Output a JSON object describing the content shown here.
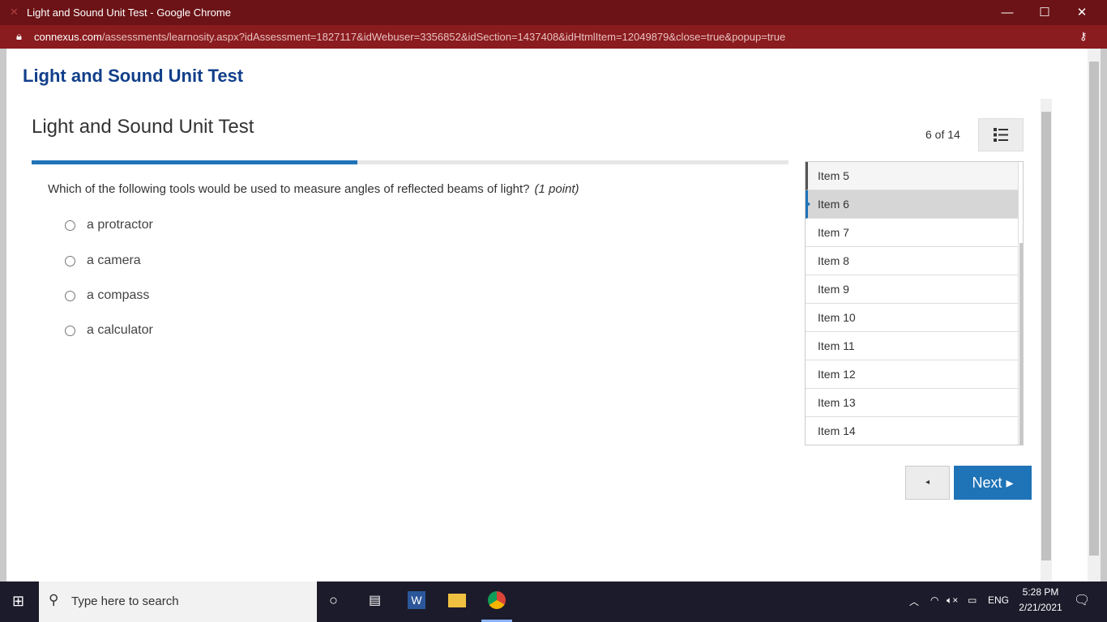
{
  "window": {
    "title": "Light and Sound Unit Test - Google Chrome"
  },
  "address": {
    "domain": "connexus.com",
    "path": "/assessments/learnosity.aspx?idAssessment=1827117&idWebuser=3356852&idSection=1437408&idHtmlItem=12049879&close=true&popup=true"
  },
  "app_title": "Light and Sound Unit Test",
  "test": {
    "title": "Light and Sound Unit Test",
    "counter": "6 of 14",
    "progress": 0.43,
    "question": "Which of the following tools would be used to measure angles of reflected beams of light?",
    "points": "(1 point)",
    "options": [
      "a protractor",
      "a camera",
      "a compass",
      "a calculator"
    ]
  },
  "items": [
    "Item 5",
    "Item 6",
    "Item 7",
    "Item 8",
    "Item 9",
    "Item 10",
    "Item 11",
    "Item 12",
    "Item 13",
    "Item 14"
  ],
  "nav": {
    "prev": "◂",
    "next": "Next ▸"
  },
  "taskbar": {
    "search_placeholder": "Type here to search",
    "lang": "ENG",
    "time": "5:28 PM",
    "date": "2/21/2021"
  }
}
